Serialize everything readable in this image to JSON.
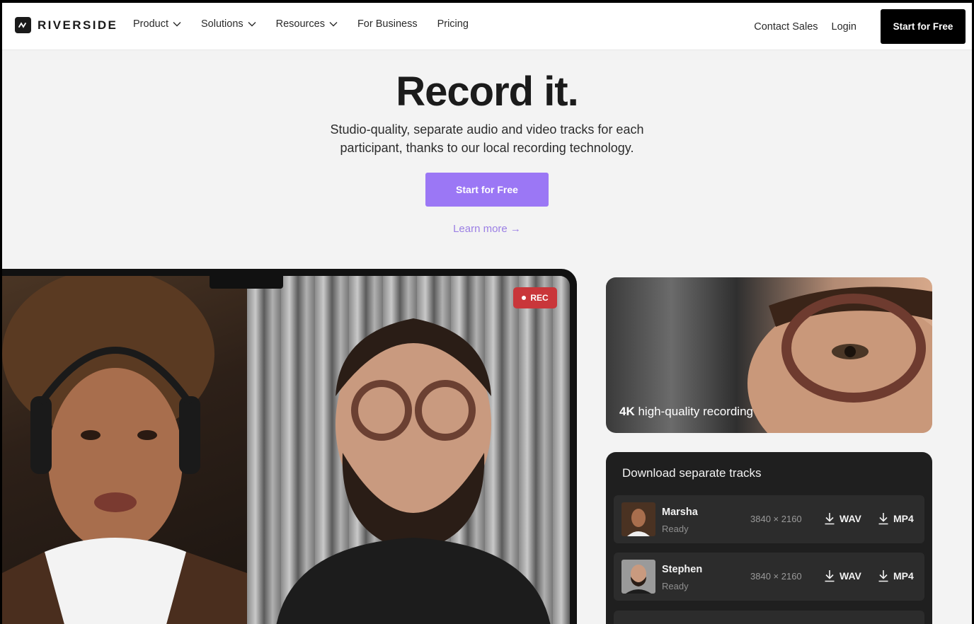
{
  "nav": {
    "logo": "RIVERSIDE",
    "links": [
      {
        "label": "Product",
        "has_dropdown": true
      },
      {
        "label": "Solutions",
        "has_dropdown": true
      },
      {
        "label": "Resources",
        "has_dropdown": true
      },
      {
        "label": "For Business",
        "has_dropdown": false
      },
      {
        "label": "Pricing",
        "has_dropdown": false
      }
    ],
    "contact": "Contact Sales",
    "login": "Login",
    "cta": "Start for Free"
  },
  "hero": {
    "title": "Record it.",
    "subtitle_line1": "Studio-quality, separate audio and video tracks for each",
    "subtitle_line2": "participant, thanks to our local recording technology.",
    "cta": "Start for Free",
    "learn_more": "Learn more →"
  },
  "device": {
    "rec_label": "REC"
  },
  "feature_4k": {
    "bold": "4K",
    "text": " high-quality recording"
  },
  "tracks": {
    "title": "Download separate tracks",
    "items": [
      {
        "name": "Marsha",
        "status": "Ready",
        "resolution": "3840 × 2160",
        "wav": "WAV",
        "mp4": "MP4"
      },
      {
        "name": "Stephen",
        "status": "Ready",
        "resolution": "3840 × 2160",
        "wav": "WAV",
        "mp4": "MP4"
      }
    ]
  },
  "colors": {
    "accent": "#9b77f5",
    "rec": "#c9363a",
    "dark_card": "#1f1f1f"
  }
}
